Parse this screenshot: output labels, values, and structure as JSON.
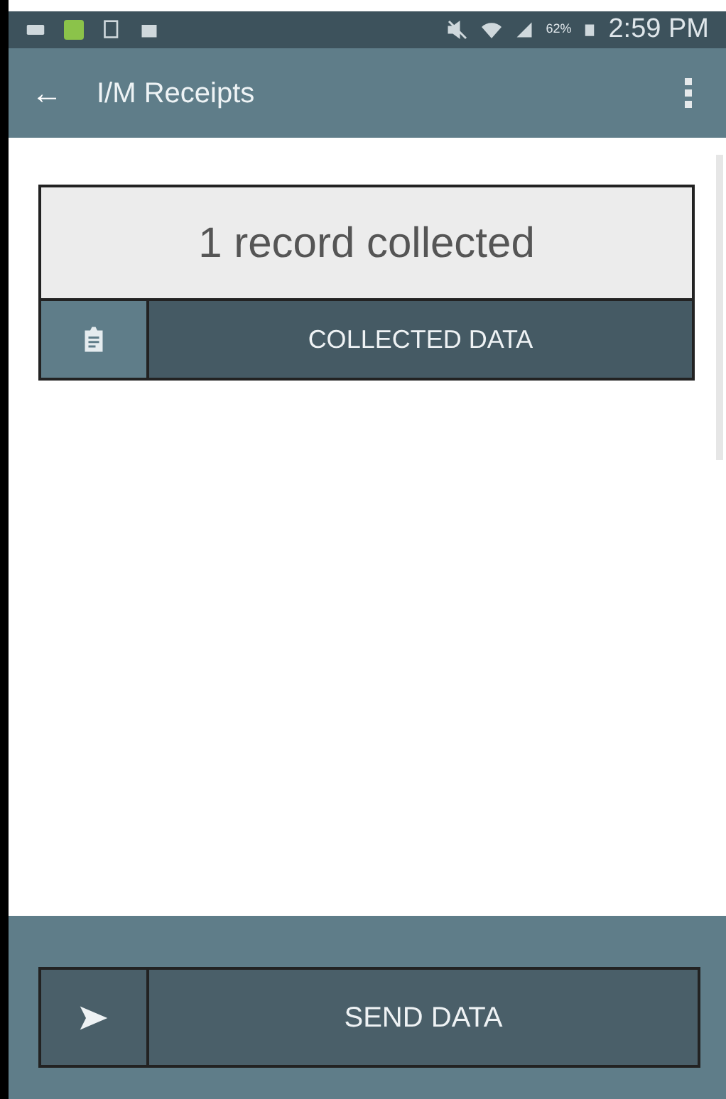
{
  "status_bar": {
    "battery": "62%",
    "time": "2:59 PM"
  },
  "app_bar": {
    "back": "←",
    "title": "I/M Receipts"
  },
  "card": {
    "summary": "1 record collected",
    "action": "COLLECTED DATA"
  },
  "footer": {
    "action": "SEND DATA"
  }
}
